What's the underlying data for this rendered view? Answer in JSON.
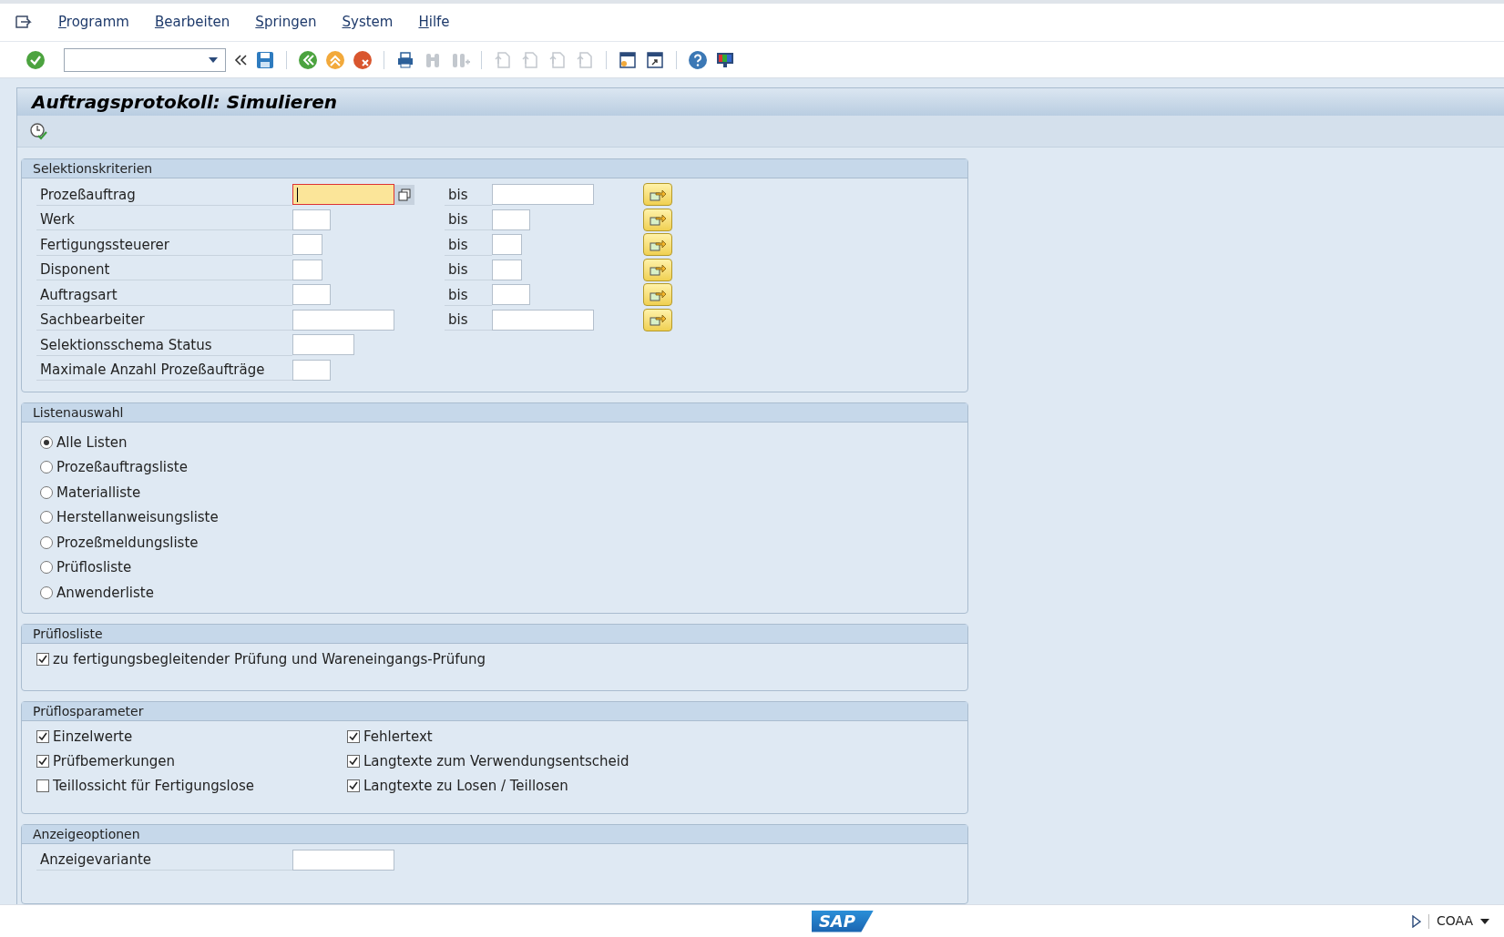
{
  "menu": [
    {
      "label": "Programm"
    },
    {
      "label": "Bearbeiten"
    },
    {
      "label": "Springen"
    },
    {
      "label": "System"
    },
    {
      "label": "Hilfe"
    }
  ],
  "title": "Auftragsprotokoll: Simulieren",
  "selection": {
    "title": "Selektionskriterien",
    "rows": [
      {
        "label": "Prozeßauftrag",
        "kind": "range",
        "focused": true,
        "to_label": "bis"
      },
      {
        "label": "Werk",
        "kind": "range",
        "focused": false,
        "to_label": "bis"
      },
      {
        "label": "Fertigungssteuerer",
        "kind": "range",
        "focused": false,
        "to_label": "bis"
      },
      {
        "label": "Disponent",
        "kind": "range",
        "focused": false,
        "to_label": "bis"
      },
      {
        "label": "Auftragsart",
        "kind": "range",
        "focused": false,
        "to_label": "bis"
      },
      {
        "label": "Sachbearbeiter",
        "kind": "range",
        "focused": false,
        "to_label": "bis"
      },
      {
        "label": "Selektionsschema Status",
        "kind": "single",
        "focused": false
      },
      {
        "label": "Maximale Anzahl Prozeßaufträge",
        "kind": "single",
        "focused": false
      }
    ]
  },
  "lists": {
    "title": "Listenauswahl",
    "options": [
      {
        "label": "Alle Listen",
        "selected": true
      },
      {
        "label": "Prozeßauftragsliste",
        "selected": false
      },
      {
        "label": "Materialliste",
        "selected": false
      },
      {
        "label": "Herstellanweisungsliste",
        "selected": false
      },
      {
        "label": "Prozeßmeldungsliste",
        "selected": false
      },
      {
        "label": "Prüflosliste",
        "selected": false
      },
      {
        "label": "Anwenderliste",
        "selected": false
      }
    ]
  },
  "inspection_list": {
    "title": "Prüflosliste",
    "options": [
      {
        "label": "zu fertigungsbegleitender Prüfung und Wareneingangs-Prüfung",
        "checked": true
      }
    ]
  },
  "inspection_params": {
    "title": "Prüflosparameter",
    "columns": [
      [
        {
          "label": "Einzelwerte",
          "checked": true
        },
        {
          "label": "Prüfbemerkungen",
          "checked": true
        },
        {
          "label": "Teillossicht für Fertigungslose",
          "checked": false
        }
      ],
      [
        {
          "label": "Fehlertext",
          "checked": true
        },
        {
          "label": "Langtexte zum Verwendungsentscheid",
          "checked": true
        },
        {
          "label": "Langtexte zu Losen / Teillosen",
          "checked": true
        }
      ]
    ]
  },
  "display_options": {
    "title": "Anzeigeoptionen",
    "rows": [
      {
        "label": "Anzeigevariante"
      }
    ]
  },
  "status_bar": {
    "logo": "SAP",
    "system": "COAA"
  }
}
